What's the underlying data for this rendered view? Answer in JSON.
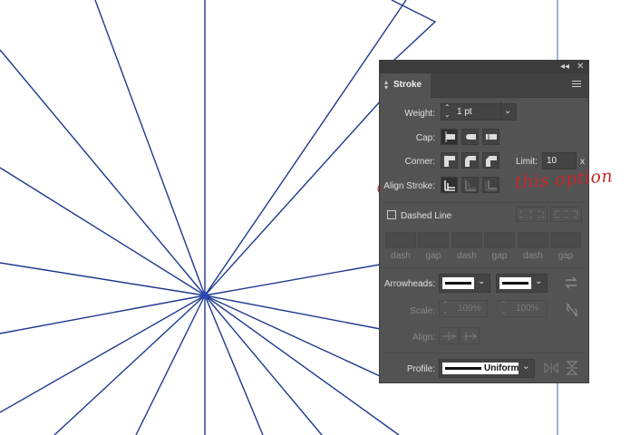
{
  "panel": {
    "title": "Stroke",
    "collapse_control": "◂◂",
    "close_control": "✕",
    "menu_icon": "menu-icon"
  },
  "weight": {
    "label": "Weight:",
    "value": "1 pt"
  },
  "cap": {
    "label": "Cap:",
    "options": [
      "butt-cap",
      "round-cap",
      "projecting-cap"
    ]
  },
  "corner": {
    "label": "Corner:",
    "options": [
      "miter-join",
      "round-join",
      "bevel-join"
    ],
    "limit_label": "Limit:",
    "limit_value": "10",
    "limit_unit": "x"
  },
  "align_stroke": {
    "label": "Align Stroke:",
    "options": [
      "align-center",
      "align-inside",
      "align-outside"
    ],
    "selected": "align-center"
  },
  "dashed_line": {
    "label": "Dashed Line",
    "checked": false,
    "labels": [
      "dash",
      "gap",
      "dash",
      "gap",
      "dash",
      "gap"
    ]
  },
  "arrowheads": {
    "label": "Arrowheads:"
  },
  "scale": {
    "label": "Scale:",
    "start": "100%",
    "end": "100%"
  },
  "align": {
    "label": "Align:"
  },
  "profile": {
    "label": "Profile:",
    "value": "Uniform"
  },
  "annotation": {
    "text": "this option",
    "color": "#c8272b"
  },
  "colors": {
    "stroke": "#1f3a8f",
    "panel_bg": "#535353"
  }
}
